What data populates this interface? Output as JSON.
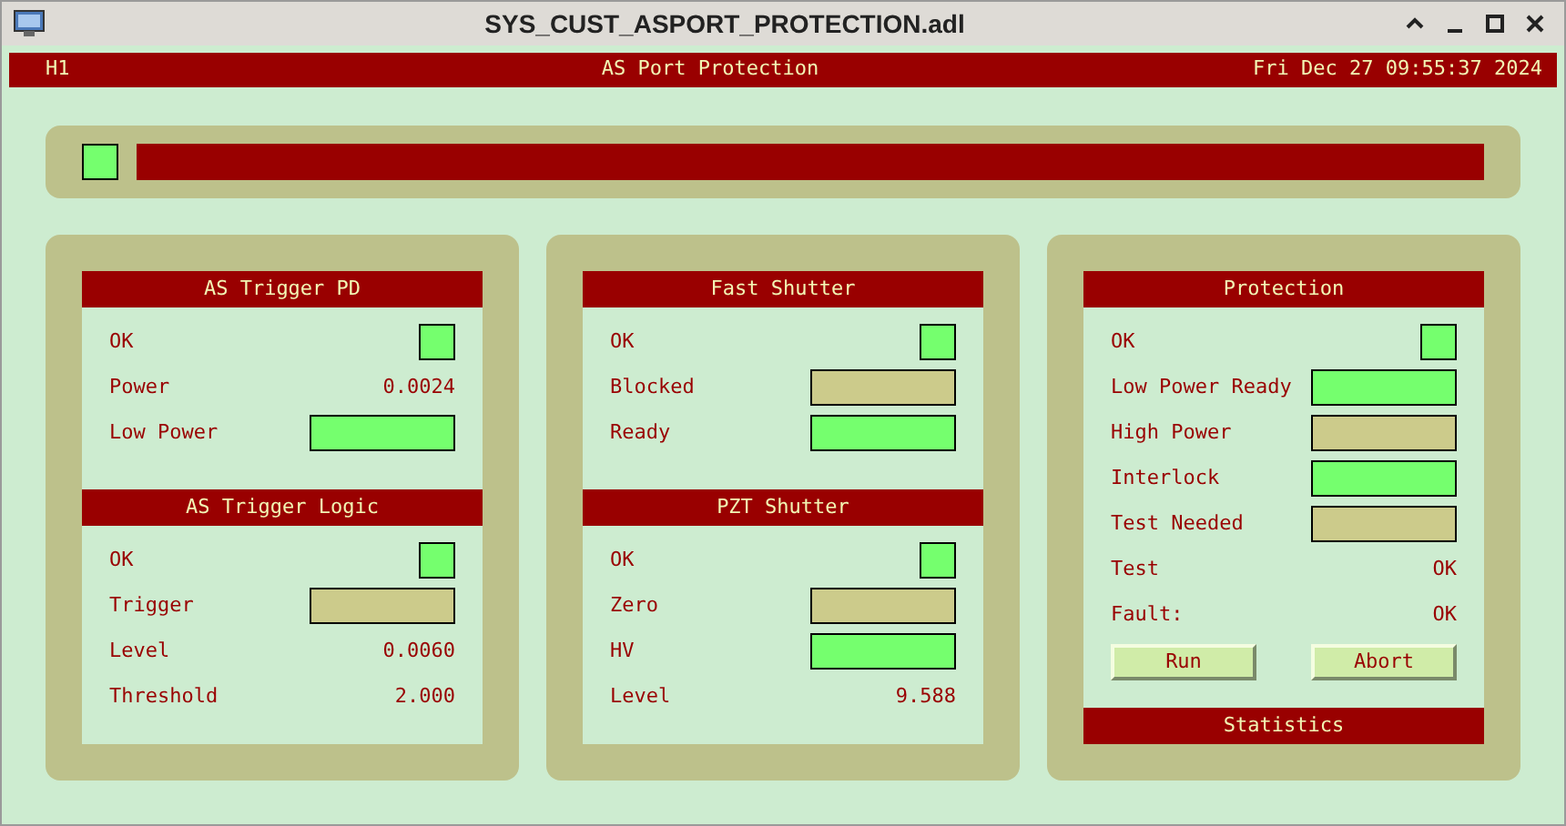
{
  "window": {
    "title": "SYS_CUST_ASPORT_PROTECTION.adl"
  },
  "header": {
    "left": "H1",
    "title": "AS Port Protection",
    "datetime": "Fri Dec 27 09:55:37 2024"
  },
  "top_bar": {
    "on": true
  },
  "panels": [
    {
      "sections": [
        {
          "title": "AS Trigger PD",
          "rows": [
            {
              "kind": "led",
              "label": "OK",
              "on": true
            },
            {
              "kind": "value",
              "label": "Power",
              "value": "0.0024"
            },
            {
              "kind": "indicator",
              "label": "Low Power",
              "on": true
            }
          ]
        },
        {
          "title": "AS Trigger Logic",
          "rows": [
            {
              "kind": "led",
              "label": "OK",
              "on": true
            },
            {
              "kind": "indicator",
              "label": "Trigger",
              "on": false
            },
            {
              "kind": "value",
              "label": "Level",
              "value": "0.0060"
            },
            {
              "kind": "value",
              "label": "Threshold",
              "value": "2.000"
            }
          ]
        }
      ]
    },
    {
      "sections": [
        {
          "title": "Fast Shutter",
          "rows": [
            {
              "kind": "led",
              "label": "OK",
              "on": true
            },
            {
              "kind": "indicator",
              "label": "Blocked",
              "on": false
            },
            {
              "kind": "indicator",
              "label": "Ready",
              "on": true
            }
          ]
        },
        {
          "title": "PZT Shutter",
          "rows": [
            {
              "kind": "led",
              "label": "OK",
              "on": true
            },
            {
              "kind": "indicator",
              "label": "Zero",
              "on": false
            },
            {
              "kind": "indicator",
              "label": "HV",
              "on": true
            },
            {
              "kind": "value",
              "label": "Level",
              "value": "9.588"
            }
          ]
        }
      ]
    },
    {
      "sections": [
        {
          "title": "Protection",
          "rows": [
            {
              "kind": "led",
              "label": "OK",
              "on": true
            },
            {
              "kind": "indicator",
              "label": "Low Power Ready",
              "on": true
            },
            {
              "kind": "indicator",
              "label": "High Power",
              "on": false
            },
            {
              "kind": "indicator",
              "label": "Interlock",
              "on": true
            },
            {
              "kind": "indicator",
              "label": "Test Needed",
              "on": false
            },
            {
              "kind": "value",
              "label": "Test",
              "value": "OK"
            },
            {
              "kind": "value",
              "label": "Fault:",
              "value": "OK"
            }
          ],
          "buttons": [
            "Run",
            "Abort"
          ]
        },
        {
          "title": "Statistics"
        }
      ]
    }
  ]
}
